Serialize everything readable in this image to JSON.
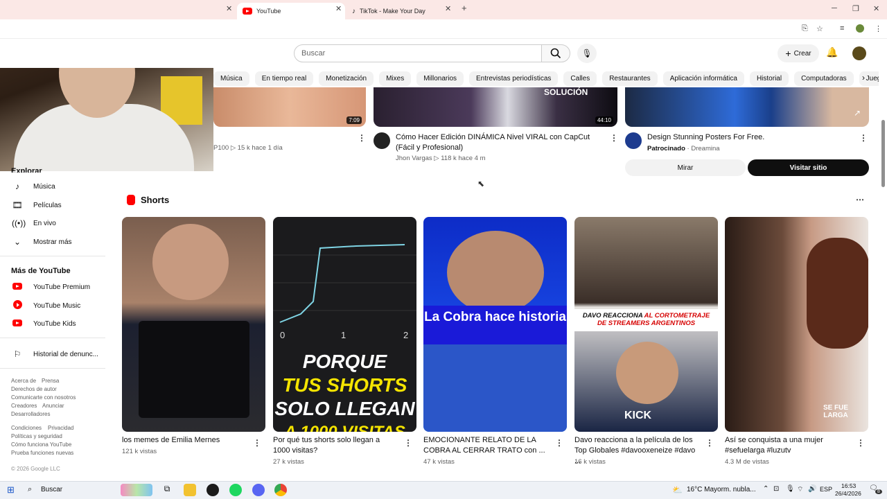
{
  "browser": {
    "tabs": [
      {
        "title": "YouTube",
        "active": true
      },
      {
        "title": "TikTok - Make Your Day",
        "active": false
      }
    ],
    "new_tab_symbol": "+",
    "window_controls": [
      "minimize",
      "restore",
      "close"
    ],
    "toolbar_icons": [
      "install-app-icon",
      "bookmark-star-icon",
      "reading-list-icon",
      "profile-icon",
      "kebab-menu-icon"
    ]
  },
  "header": {
    "search_placeholder": "Buscar",
    "create_label": "Crear",
    "icons": [
      "search-icon",
      "mic-icon",
      "bell-icon",
      "avatar"
    ]
  },
  "chips": [
    "Música",
    "En tiempo real",
    "Monetización",
    "Mixes",
    "Millonarios",
    "Entrevistas periodísticas",
    "Calles",
    "Restaurantes",
    "Aplicación informática",
    "Historial",
    "Computadoras",
    "Juegos de aventu"
  ],
  "videos": [
    {
      "duration": "7:09",
      "meta_views": "P100  ▷ 15 k  hace 1 día"
    },
    {
      "duration": "44:10",
      "overlay": "SOLUCIÓN",
      "title": "Cómo Hacer Edición DINÁMICA Nivel VIRAL con CapCut (Fácil y Profesional)",
      "channel": "Jhon Vargas",
      "meta": "▷ 118 k  hace 4 m"
    },
    {
      "title": "Design Stunning Posters For Free.",
      "sponsored": "Patrocinado",
      "channel": "Dreamina",
      "btn_watch": "Mirar",
      "btn_visit": "Visitar sitio"
    }
  ],
  "sidebar": {
    "explore_heading": "Explorar",
    "explore_items": [
      {
        "icon": "music-note-icon",
        "label": "Música"
      },
      {
        "icon": "film-icon",
        "label": "Películas"
      },
      {
        "icon": "live-icon",
        "label": "En vivo"
      },
      {
        "icon": "chevron-down-icon",
        "label": "Mostrar más"
      }
    ],
    "more_heading": "Más de YouTube",
    "more_items": [
      {
        "icon": "youtube-premium-icon",
        "label": "YouTube Premium"
      },
      {
        "icon": "youtube-music-icon",
        "label": "YouTube Music"
      },
      {
        "icon": "youtube-kids-icon",
        "label": "YouTube Kids"
      }
    ],
    "report_item": {
      "icon": "flag-icon",
      "label": "Historial de denunc..."
    },
    "footer_links_1": [
      "Acerca de",
      "Prensa",
      "Derechos de autor",
      "Comunicarte con nosotros",
      "Creadores",
      "Anunciar",
      "Desarrolladores"
    ],
    "footer_links_2": [
      "Condiciones",
      "Privacidad",
      "Políticas y seguridad",
      "Cómo funciona YouTube",
      "Prueba funciones nuevas"
    ],
    "copyright": "© 2026 Google LLC"
  },
  "shorts": {
    "heading": "Shorts",
    "items": [
      {
        "title": "los memes de Emilia Mernes",
        "views": "121 k vistas"
      },
      {
        "title": "Por qué tus shorts solo llegan a 1000 visitas?",
        "views": "27 k vistas",
        "overlay_line1": "PORQUE",
        "overlay_line2": "TUS SHORTS",
        "overlay_line3": "SOLO LLEGAN",
        "overlay_line4": "A 1000 VISITAS",
        "axis": [
          "0",
          "1",
          "2"
        ]
      },
      {
        "title": "EMOCIONANTE RELATO DE LA COBRA AL CERRAR TRATO con ...",
        "views": "47 k vistas",
        "overlay": "La Cobra hace historia"
      },
      {
        "title": "Davo reacciona a la película de los Top Globales #davooxeneize #davo ...",
        "views": "16 k vistas",
        "overlay_red": "DAVO REACCIONA",
        "overlay_red2": "AL CORTOMETRAJE",
        "overlay_red3": "DE STREAMERS ARGENTINOS",
        "overlay_kick": "KICK"
      },
      {
        "title": "Así se conquista a una mujer #sefuelarga #luzutv",
        "views": "4.3 M de vistas",
        "overlay": "SE FUE LARGA"
      }
    ]
  },
  "taskbar": {
    "search_label": "Buscar",
    "weather": "16°C  Mayorm. nubla...",
    "lang": "ESP",
    "time": "16:53",
    "date": "26/4/2026",
    "notification_count": "8"
  },
  "colors": {
    "accent": "#ff0000",
    "tab_bar": "#fbe8e6",
    "visit_button": "#0f0f0f"
  }
}
